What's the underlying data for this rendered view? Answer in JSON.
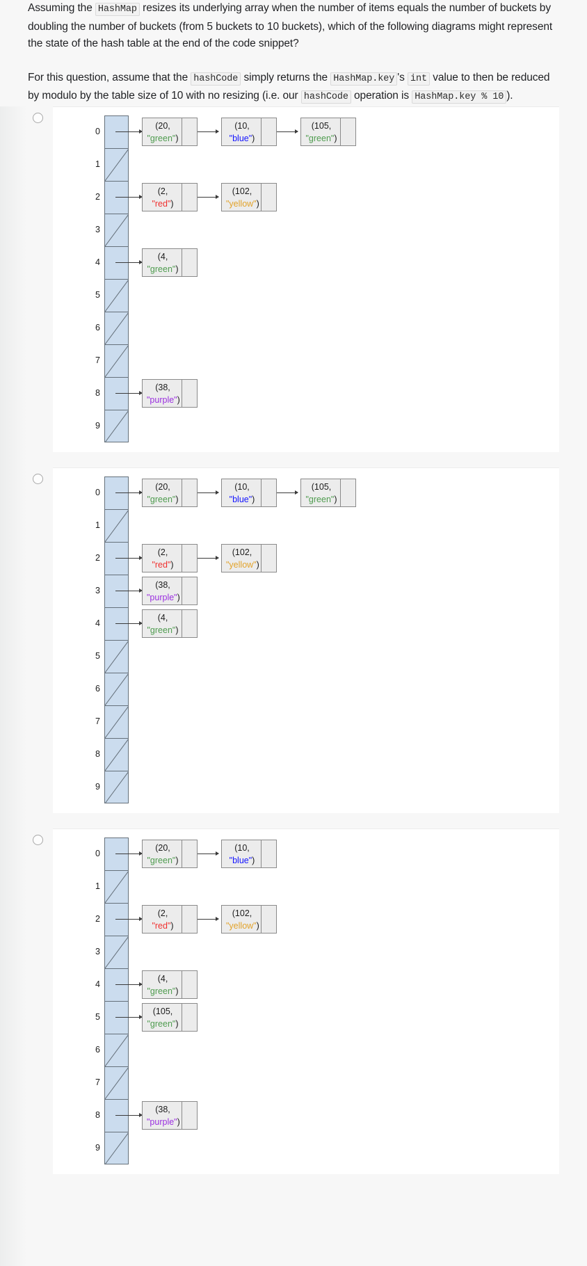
{
  "question": {
    "paragraph1": {
      "seg1": "Assuming the ",
      "code1": "HashMap",
      "seg2": " resizes its underlying array when the number of items equals the number of buckets by doubling the number of buckets (from 5 buckets to 10 buckets), which of the following diagrams might represent the state of the hash table at the end of the code snippet?"
    },
    "paragraph2": {
      "seg1": "For this question, assume that the ",
      "code1": "hashCode",
      "seg2": " simply returns the ",
      "code2": "HashMap.key",
      "seg3": "'s ",
      "code3": "int",
      "seg4": " value to then be reduced by modulo by the table size of 10 with no resizing (i.e. our ",
      "code4": "hashCode",
      "seg5": " operation is ",
      "code5": "HashMap.key % 10",
      "seg6": ")."
    }
  },
  "colors": {
    "bucket_fill": "#cbdcee",
    "bucket_border": "#65707a",
    "node_fill": "#ececec",
    "node_border": "#8a8a8a",
    "green": "#4f9c4f",
    "blue": "#1414ff",
    "red": "#f0302f",
    "yellow": "#e2a32b",
    "purple": "#9b30e0",
    "page_bg": "#f7f7f7",
    "option_bg": "#ffffff"
  },
  "options": [
    {
      "id": "option-a",
      "selected": false,
      "buckets": [
        {
          "index": "0",
          "nodes": [
            {
              "key": "(20,",
              "color_text": "\"green\"",
              "color_class": "c-green",
              "tail": ")"
            },
            {
              "key": "(10,",
              "color_text": "\"blue\"",
              "color_class": "c-blue",
              "tail": ")"
            },
            {
              "key": "(105,",
              "color_text": "\"green\"",
              "color_class": "c-green",
              "tail": ")"
            }
          ]
        },
        {
          "index": "1",
          "nodes": []
        },
        {
          "index": "2",
          "nodes": [
            {
              "key": "(2,",
              "color_text": "\"red\"",
              "color_class": "c-red",
              "tail": ")"
            },
            {
              "key": "(102,",
              "color_text": "\"yellow\"",
              "color_class": "c-yellow",
              "tail": ")"
            }
          ]
        },
        {
          "index": "3",
          "nodes": []
        },
        {
          "index": "4",
          "nodes": [
            {
              "key": "(4,",
              "color_text": "\"green\"",
              "color_class": "c-green",
              "tail": ")"
            }
          ]
        },
        {
          "index": "5",
          "nodes": []
        },
        {
          "index": "6",
          "nodes": []
        },
        {
          "index": "7",
          "nodes": []
        },
        {
          "index": "8",
          "nodes": [
            {
              "key": "(38,",
              "color_text": "\"purple\"",
              "color_class": "c-purple",
              "tail": ")"
            }
          ]
        },
        {
          "index": "9",
          "nodes": []
        }
      ]
    },
    {
      "id": "option-b",
      "selected": false,
      "buckets": [
        {
          "index": "0",
          "nodes": [
            {
              "key": "(20,",
              "color_text": "\"green\"",
              "color_class": "c-green",
              "tail": ")"
            },
            {
              "key": "(10,",
              "color_text": "\"blue\"",
              "color_class": "c-blue",
              "tail": ")"
            },
            {
              "key": "(105,",
              "color_text": "\"green\"",
              "color_class": "c-green",
              "tail": ")"
            }
          ]
        },
        {
          "index": "1",
          "nodes": []
        },
        {
          "index": "2",
          "nodes": [
            {
              "key": "(2,",
              "color_text": "\"red\"",
              "color_class": "c-red",
              "tail": ")"
            },
            {
              "key": "(102,",
              "color_text": "\"yellow\"",
              "color_class": "c-yellow",
              "tail": ")"
            }
          ]
        },
        {
          "index": "3",
          "nodes": [
            {
              "key": "(38,",
              "color_text": "\"purple\"",
              "color_class": "c-purple",
              "tail": ")"
            }
          ]
        },
        {
          "index": "4",
          "nodes": [
            {
              "key": "(4,",
              "color_text": "\"green\"",
              "color_class": "c-green",
              "tail": ")"
            }
          ]
        },
        {
          "index": "5",
          "nodes": []
        },
        {
          "index": "6",
          "nodes": []
        },
        {
          "index": "7",
          "nodes": []
        },
        {
          "index": "8",
          "nodes": []
        },
        {
          "index": "9",
          "nodes": []
        }
      ]
    },
    {
      "id": "option-c",
      "selected": false,
      "buckets": [
        {
          "index": "0",
          "nodes": [
            {
              "key": "(20,",
              "color_text": "\"green\"",
              "color_class": "c-green",
              "tail": ")"
            },
            {
              "key": "(10,",
              "color_text": "\"blue\"",
              "color_class": "c-blue",
              "tail": ")"
            }
          ]
        },
        {
          "index": "1",
          "nodes": []
        },
        {
          "index": "2",
          "nodes": [
            {
              "key": "(2,",
              "color_text": "\"red\"",
              "color_class": "c-red",
              "tail": ")"
            },
            {
              "key": "(102,",
              "color_text": "\"yellow\"",
              "color_class": "c-yellow",
              "tail": ")"
            }
          ]
        },
        {
          "index": "3",
          "nodes": []
        },
        {
          "index": "4",
          "nodes": [
            {
              "key": "(4,",
              "color_text": "\"green\"",
              "color_class": "c-green",
              "tail": ")"
            }
          ]
        },
        {
          "index": "5",
          "nodes": [
            {
              "key": "(105,",
              "color_text": "\"green\"",
              "color_class": "c-green",
              "tail": ")"
            }
          ]
        },
        {
          "index": "6",
          "nodes": []
        },
        {
          "index": "7",
          "nodes": []
        },
        {
          "index": "8",
          "nodes": [
            {
              "key": "(38,",
              "color_text": "\"purple\"",
              "color_class": "c-purple",
              "tail": ")"
            }
          ]
        },
        {
          "index": "9",
          "nodes": []
        }
      ]
    }
  ]
}
